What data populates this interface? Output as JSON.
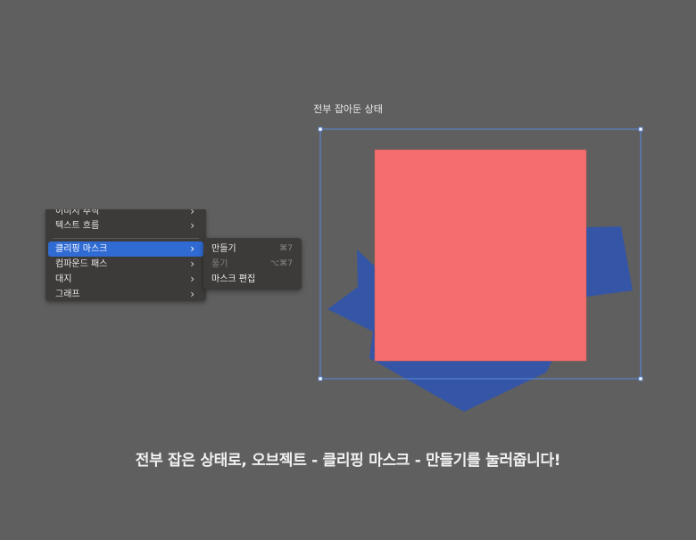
{
  "captions": {
    "top": "전부 잡아둔 상태",
    "bottom": "전부 잡은 상태로, 오브젝트 - 클리핑 마스크 - 만들기를 눌러줍니다!"
  },
  "menu": {
    "items": [
      {
        "label": "이미지 추적",
        "has_submenu": true
      },
      {
        "label": "텍스트 흐름",
        "has_submenu": true
      },
      {
        "label": "클리핑 마스크",
        "has_submenu": true,
        "active": true
      },
      {
        "label": "컴파운드 패스",
        "has_submenu": true
      },
      {
        "label": "대지",
        "has_submenu": true
      },
      {
        "label": "그래프",
        "has_submenu": true
      }
    ],
    "arrow_icon": "chevron-right-icon"
  },
  "submenu": {
    "items": [
      {
        "label": "만들기",
        "shortcut": "⌘7",
        "enabled": true
      },
      {
        "label": "풀기",
        "shortcut": "⌥⌘7",
        "enabled": false
      },
      {
        "label": "마스크 편집",
        "shortcut": "",
        "enabled": true
      }
    ]
  },
  "colors": {
    "background": "#5f5f5f",
    "square": "#f56e6e",
    "star": "#3555a6",
    "selection": "#5a8be0",
    "menu_bg": "#3d3b39",
    "menu_active": "#2f6bd3"
  }
}
